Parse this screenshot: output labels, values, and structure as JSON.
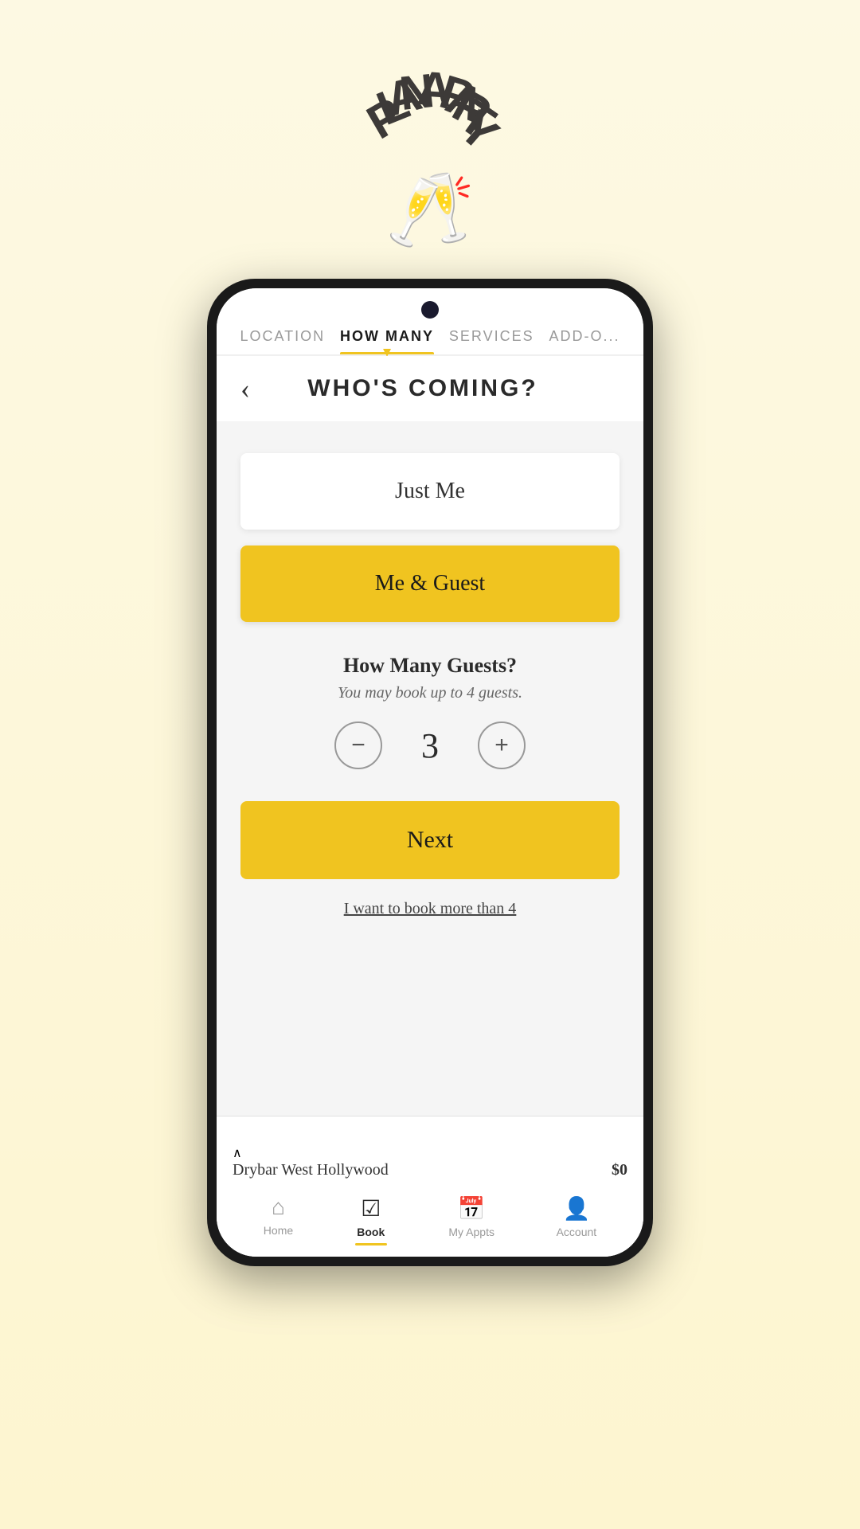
{
  "page": {
    "background_gradient_start": "#fdf9e3",
    "background_gradient_end": "#fdf5d0"
  },
  "header": {
    "title": "PLAN A PARTY",
    "icon": "🥂"
  },
  "tabs": [
    {
      "id": "location",
      "label": "LOCATION",
      "active": false
    },
    {
      "id": "how_many",
      "label": "HOW MANY",
      "active": true
    },
    {
      "id": "services",
      "label": "SERVICES",
      "active": false
    },
    {
      "id": "add_ons",
      "label": "ADD-O...",
      "active": false
    }
  ],
  "screen": {
    "back_label": "‹",
    "title": "WHO'S COMING?",
    "options": [
      {
        "id": "just_me",
        "label": "Just Me",
        "style": "white"
      },
      {
        "id": "me_and_guest",
        "label": "Me & Guest",
        "style": "yellow"
      }
    ],
    "guest_section": {
      "title": "How Many Guests?",
      "subtitle": "You may book up to 4 guests.",
      "count": "3",
      "decrement_label": "−",
      "increment_label": "+"
    },
    "next_button": "Next",
    "book_more_link": "I want to book more than 4"
  },
  "bottom_info": {
    "chevron": "∧",
    "location": "Drybar West Hollywood",
    "price": "$0"
  },
  "nav": [
    {
      "id": "home",
      "label": "Home",
      "icon": "⌂",
      "active": false
    },
    {
      "id": "book",
      "label": "Book",
      "icon": "☑",
      "active": true
    },
    {
      "id": "my_appts",
      "label": "My Appts",
      "icon": "📅",
      "active": false
    },
    {
      "id": "account",
      "label": "Account",
      "icon": "👤",
      "active": false
    }
  ]
}
